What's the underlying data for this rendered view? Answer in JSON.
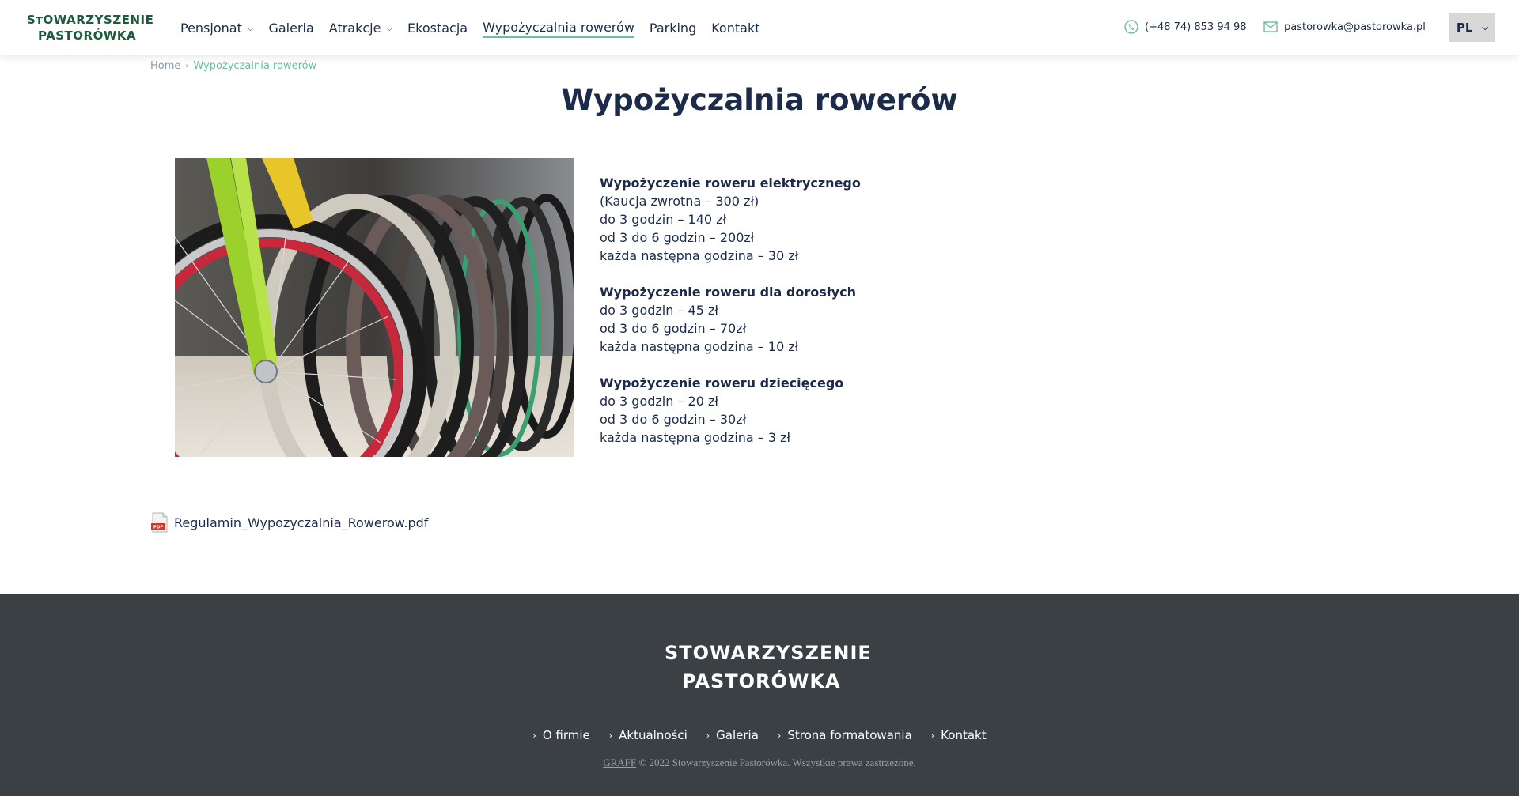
{
  "header": {
    "logo_line1": "SᴛOWARZYSZENIE",
    "logo_line2": "PASTORÓWKA",
    "nav": [
      {
        "label": "Pensjonat",
        "dropdown": true
      },
      {
        "label": "Galeria",
        "dropdown": false
      },
      {
        "label": "Atrakcje",
        "dropdown": true
      },
      {
        "label": "Ekostacja",
        "dropdown": false
      },
      {
        "label": "Wypożyczalnia rowerów",
        "dropdown": false,
        "active": true
      },
      {
        "label": "Parking",
        "dropdown": false
      },
      {
        "label": "Kontakt",
        "dropdown": false
      }
    ],
    "phone": "(+48 74) 853 94 98",
    "email": "pastorowka@pastorowka.pl",
    "language": "PL"
  },
  "breadcrumb": {
    "home": "Home",
    "current": "Wypożyczalnia rowerów"
  },
  "page_title": "Wypożyczalnia rowerów",
  "pricing": [
    {
      "heading": "Wypożyczenie roweru elektrycznego",
      "lines": [
        "(Kaucja zwrotna – 300 zł)",
        "do 3 godzin – 140 zł",
        "od 3 do 6 godzin – 200zł",
        "każda następna godzina – 30 zł"
      ]
    },
    {
      "heading": "Wypożyczenie roweru dla dorosłych",
      "lines": [
        "do 3 godzin – 45 zł",
        "od 3 do 6 godzin – 70zł",
        "każda następna godzina – 10 zł"
      ]
    },
    {
      "heading": "Wypożyczenie roweru dziecięcego",
      "lines": [
        "do 3 godzin – 20 zł",
        "od 3 do 6 godzin – 30zł",
        "każda następna godzina – 3 zł"
      ]
    }
  ],
  "attachment": {
    "filename": "Regulamin_Wypozyczalnia_Rowerow.pdf",
    "icon_label": "PDF"
  },
  "footer": {
    "logo_line1": "STOWARZYSZENIE",
    "logo_line2": "PASTORÓWKA",
    "links": [
      "O firmie",
      "Aktualności",
      "Galeria",
      "Strona formatowania",
      "Kontakt"
    ],
    "credit": "GRAFF",
    "copyright": "© 2022 Stowarzyszenie Pastorówka. Wszystkie prawa zastrzeżone."
  },
  "colors": {
    "navy": "#1c2b4a",
    "green": "#6bbf9a",
    "logo_green": "#1e5a3c",
    "footer_bg": "#3b4045"
  }
}
